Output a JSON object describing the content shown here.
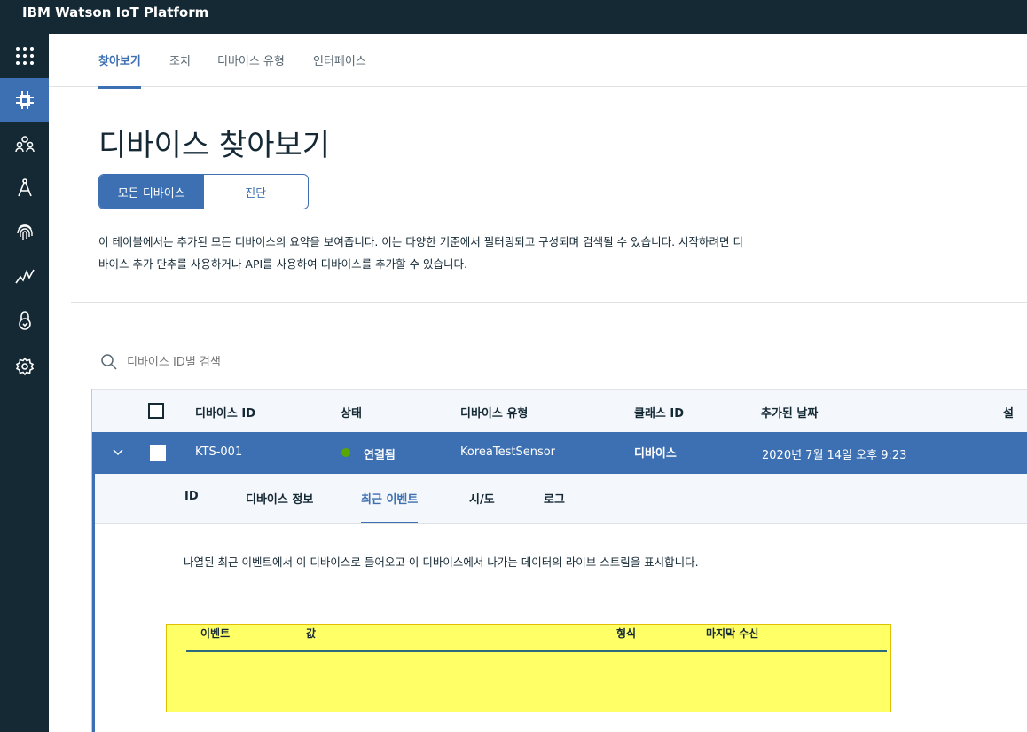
{
  "app": {
    "title": "IBM Watson IoT Platform"
  },
  "nav_tabs": [
    "찾아보기",
    "조치",
    "디바이스 유형",
    "인터페이스"
  ],
  "page": {
    "title": "디바이스 찾아보기",
    "toggle": {
      "all": "모든 디바이스",
      "diagnostics": "진단"
    },
    "description_line1": "이 테이블에서는 추가된 모든 디바이스의 요약을 보여줍니다. 이는 다양한 기준에서 필터링되고 구성되며 검색될 수 있습니다. 시작하려면 디",
    "description_line2": "바이스 추가 단추를 사용하거나 API를 사용하여 디바이스를 추가할 수 있습니다."
  },
  "search": {
    "placeholder": "디바이스 ID별 검색"
  },
  "table": {
    "columns": [
      "디바이스 ID",
      "상태",
      "디바이스 유형",
      "클래스 ID",
      "추가된 날짜",
      "설"
    ],
    "row": {
      "device_id": "KTS-001",
      "status": "연결됨",
      "device_type": "KoreaTestSensor",
      "class_id": "디바이스",
      "added_date": "2020년 7월 14일 오후 9:23"
    }
  },
  "detail": {
    "tabs": [
      "ID",
      "디바이스 정보",
      "최근 이벤트",
      "시/도",
      "로그"
    ],
    "active_tab": "최근 이벤트",
    "info": "나열된 최근 이벤트에서 이 디바이스로 들어오고 이 디바이스에서 나가는 데이터의 라이브 스트림을 표시합니다.",
    "event_columns": [
      "이벤트",
      "값",
      "형식",
      "마지막 수신"
    ]
  },
  "colors": {
    "sidebar": "#152935",
    "accent": "#3d70b2",
    "status_connected": "#5aa700",
    "highlight": "#ffff66"
  },
  "sidebar_icons": [
    "apps-grid-icon",
    "devices-chip-icon",
    "members-icon",
    "apps-compass-icon",
    "fingerprint-icon",
    "analytics-icon",
    "security-lock-icon",
    "settings-gear-icon"
  ]
}
